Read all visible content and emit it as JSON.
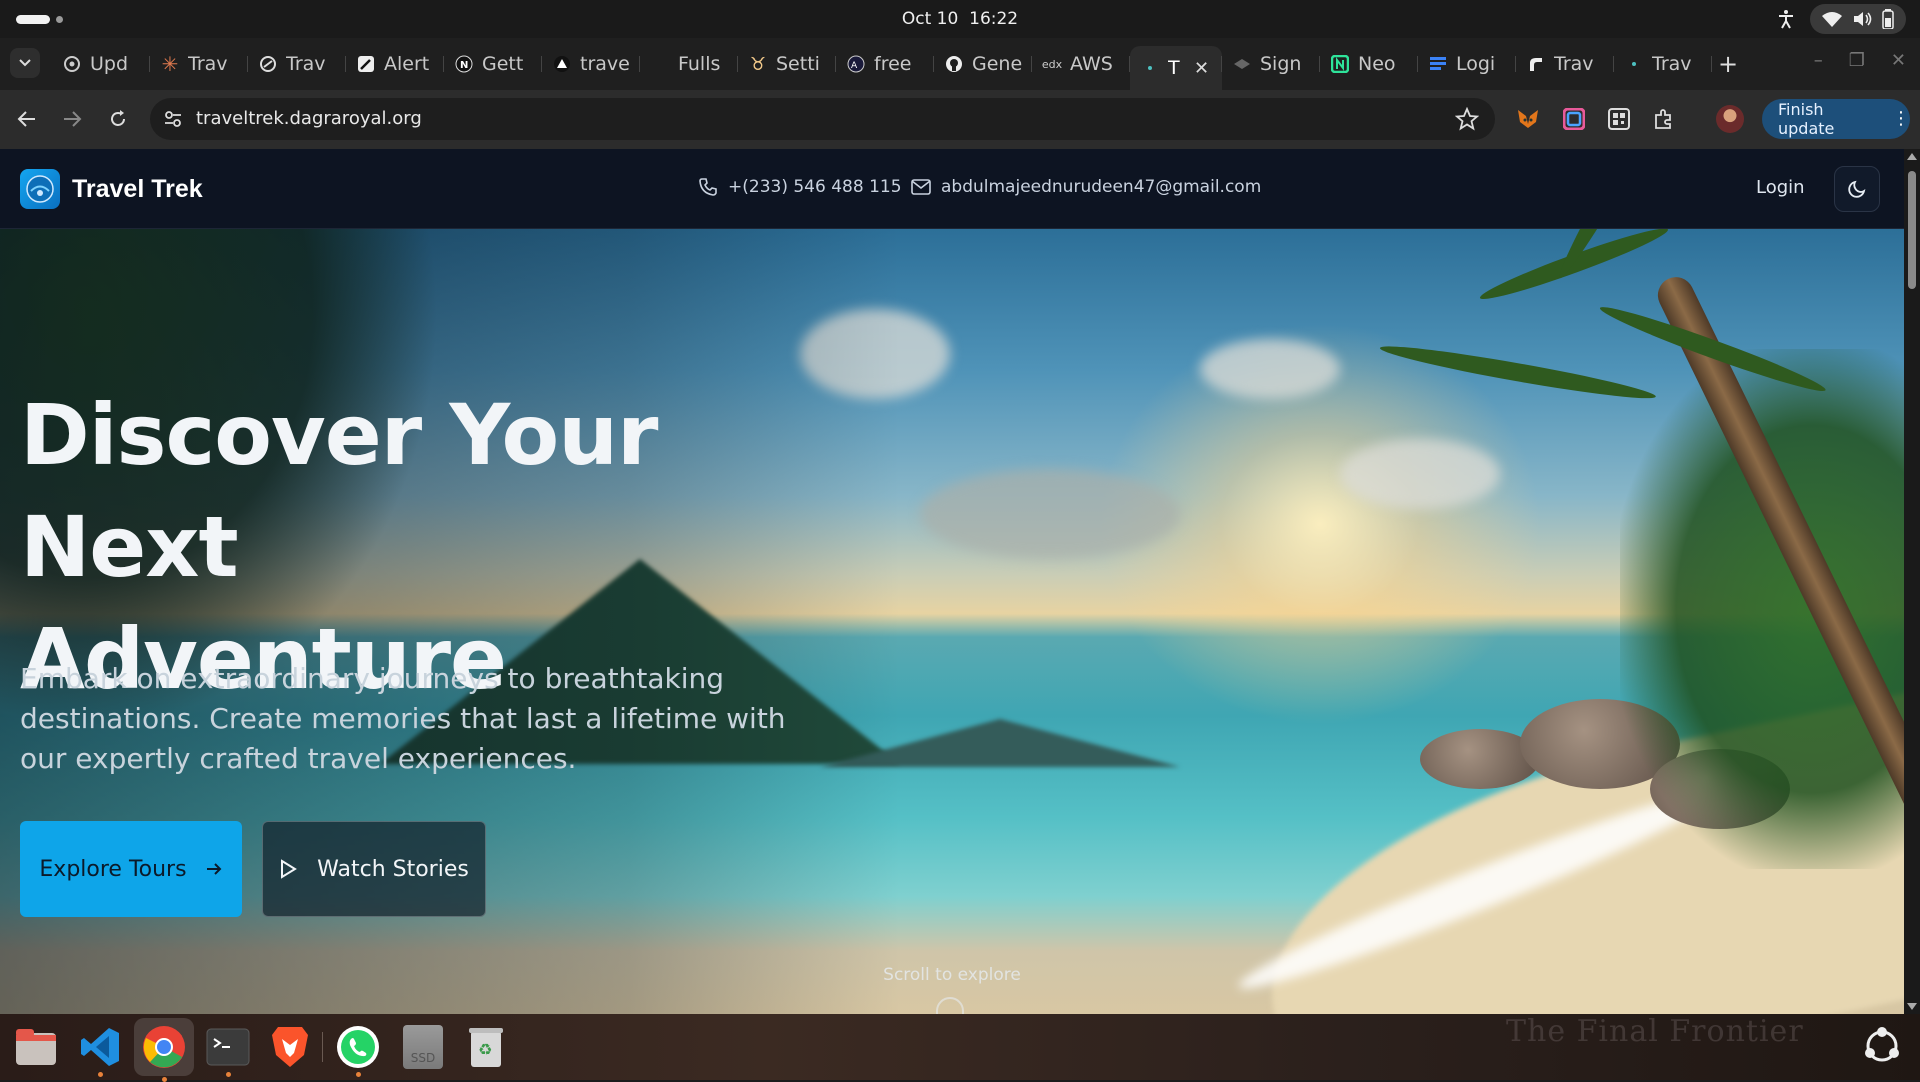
{
  "os": {
    "date": "Oct 10",
    "time": "16:22"
  },
  "browser": {
    "tabs": [
      {
        "title": "Upd",
        "icon": "settings-gear-icon"
      },
      {
        "title": "Trav",
        "icon": "claude-icon"
      },
      {
        "title": "Trav",
        "icon": "chatgpt-icon"
      },
      {
        "title": "Alert",
        "icon": "pen-icon"
      },
      {
        "title": "Gett",
        "icon": "notion-icon"
      },
      {
        "title": "trave",
        "icon": "vercel-icon"
      },
      {
        "title": "Fulls",
        "icon": "blank-icon"
      },
      {
        "title": "Setti",
        "icon": "bun-icon"
      },
      {
        "title": "free",
        "icon": "appwrite-icon"
      },
      {
        "title": "Gene",
        "icon": "github-icon"
      },
      {
        "title": "AWS",
        "icon": "aws-icon"
      },
      {
        "title": "T",
        "icon": "dot-icon",
        "active": true
      },
      {
        "title": "Sign",
        "icon": "layers-icon"
      },
      {
        "title": "Neo",
        "icon": "neon-icon"
      },
      {
        "title": "Logi",
        "icon": "stack-icon"
      },
      {
        "title": "Trav",
        "icon": "render-icon"
      },
      {
        "title": "Trav",
        "icon": "dot-icon"
      }
    ],
    "url": "traveltrek.dagraroyal.org",
    "finish_update": "Finish update"
  },
  "site": {
    "brand": "Travel Trek",
    "phone": "+(233) 546 488 115",
    "email": "abdulmajeednurudeen47@gmail.com",
    "login": "Login",
    "hero": {
      "title_line1": "Discover Your Next",
      "title_line2": "Adventure",
      "subtitle": "Embark on extraordinary journeys to breathtaking destinations. Create memories that last a lifetime with our expertly crafted travel experiences.",
      "explore_label": "Explore Tours",
      "watch_label": "Watch Stories",
      "scroll_hint": "Scroll to explore"
    }
  },
  "dock": {
    "items": [
      "files",
      "vscode",
      "chrome",
      "terminal",
      "brave",
      "whatsapp",
      "ssd-drive",
      "trash"
    ],
    "ssd_label": "SSD",
    "wallpaper_text": "The Final Frontier"
  },
  "colors": {
    "accent": "#0ea5e9",
    "header_bg": "#0d1422",
    "update_button": "#1d4f7a"
  }
}
